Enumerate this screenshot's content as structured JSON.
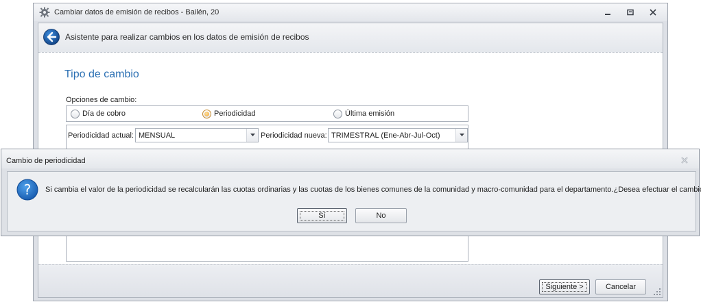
{
  "window": {
    "title": "Cambiar datos de emisión de recibos - Bailén, 20"
  },
  "header": {
    "title": "Asistente para realizar cambios en los datos de emisión de recibos"
  },
  "content": {
    "section_title": "Tipo de cambio",
    "options_label": "Opciones de cambio:",
    "radio_options": [
      {
        "label": "Día de cobro",
        "checked": false
      },
      {
        "label": "Periodicidad",
        "checked": true
      },
      {
        "label": "Última emisión",
        "checked": false
      }
    ],
    "current_periodicity_label": "Periodicidad actual:",
    "current_periodicity_value": "MENSUAL",
    "new_periodicity_label": "Periodicidad nueva:",
    "new_periodicity_value": "TRIMESTRAL (Ene-Abr-Jul-Oct)"
  },
  "footer": {
    "next_label": "Siguiente >",
    "cancel_label": "Cancelar"
  },
  "dialog": {
    "title": "Cambio de periodicidad",
    "message": "Si cambia el valor de la periodicidad se recalcularán las cuotas ordinarias y las cuotas de los bienes comunes de la comunidad y  macro-comunidad para el departamento.¿Desea efectuar el cambio?",
    "yes_label": "Sí",
    "no_label": "No"
  },
  "icons": {
    "app": "gear-icon",
    "back": "back-arrow-icon",
    "question": "question-icon",
    "minimize": "minimize-icon",
    "maximize": "maximize-icon",
    "close": "close-icon"
  },
  "colors": {
    "accent": "#2a6fb3",
    "question_icon": "#1f6fc5",
    "radio_selected": "#f0a12d"
  }
}
